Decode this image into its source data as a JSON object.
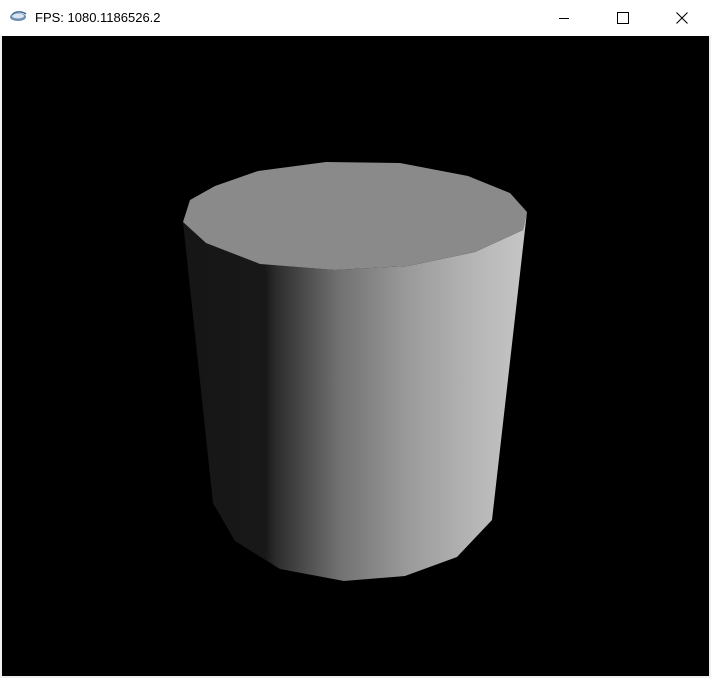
{
  "window": {
    "title": "FPS: 1080.1186526.2",
    "app_icon": "java-cup-icon",
    "controls": {
      "minimize_icon": "minimize-icon",
      "maximize_icon": "maximize-icon",
      "close_icon": "close-icon"
    }
  },
  "scene": {
    "background_color": "#000000",
    "object": "cylinder",
    "top_color": "#8a8a8a",
    "side_dark_color": "#161616",
    "side_light_color": "#c2c2c2"
  }
}
